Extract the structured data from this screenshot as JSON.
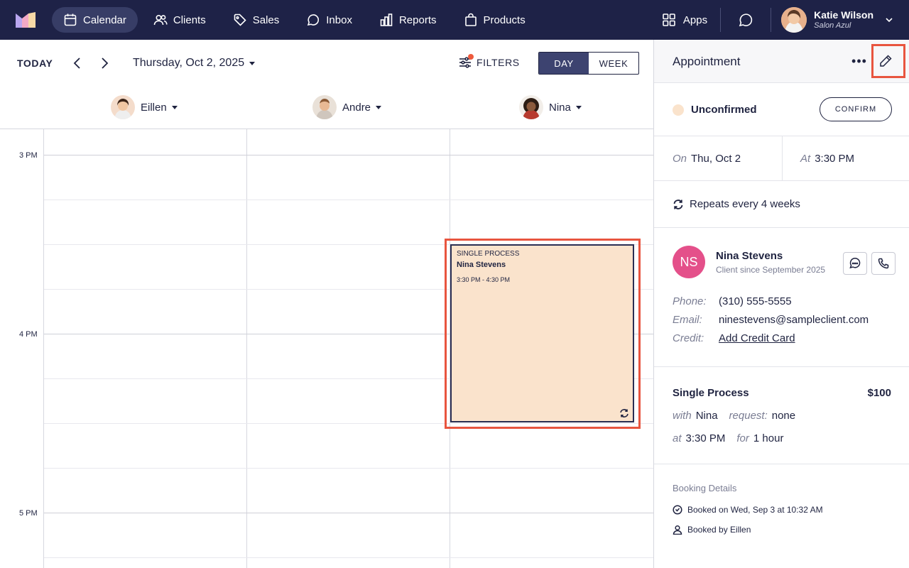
{
  "nav": {
    "items": [
      {
        "label": "Calendar",
        "icon": "calendar-icon"
      },
      {
        "label": "Clients",
        "icon": "users-icon"
      },
      {
        "label": "Sales",
        "icon": "tag-icon"
      },
      {
        "label": "Inbox",
        "icon": "inbox-icon"
      },
      {
        "label": "Reports",
        "icon": "bar-chart-icon"
      },
      {
        "label": "Products",
        "icon": "shopping-bag-icon"
      }
    ],
    "apps_label": "Apps",
    "user_name": "Katie Wilson",
    "user_salon": "Salon Azul"
  },
  "toolbar": {
    "today": "TODAY",
    "date": "Thursday, Oct 2, 2025",
    "filters": "FILTERS",
    "view_day": "DAY",
    "view_week": "WEEK"
  },
  "staff": [
    {
      "name": "Eillen"
    },
    {
      "name": "Andre"
    },
    {
      "name": "Nina"
    }
  ],
  "times": [
    "3 PM",
    "4 PM",
    "5 PM"
  ],
  "appointment_block": {
    "service": "SINGLE PROCESS",
    "client": "Nina Stevens",
    "time": "3:30 PM - 4:30 PM"
  },
  "panel": {
    "title": "Appointment",
    "more": "•••",
    "status": "Unconfirmed",
    "confirm": "CONFIRM",
    "on_label": "On",
    "on_value": "Thu, Oct 2",
    "at_label": "At",
    "at_value": "3:30 PM",
    "repeat": "Repeats every 4 weeks",
    "client": {
      "initials": "NS",
      "name": "Nina Stevens",
      "since": "Client since September 2025",
      "phone_label": "Phone:",
      "phone": "(310) 555-5555",
      "email_label": "Email:",
      "email": "ninestevens@sampleclient.com",
      "credit_label": "Credit:",
      "credit": "Add Credit Card"
    },
    "service": {
      "name": "Single Process",
      "price": "$100",
      "with_label": "with",
      "with_value": "Nina",
      "request_label": "request:",
      "request_value": "none",
      "at_label": "at",
      "at_value": "3:30 PM",
      "for_label": "for",
      "for_value": "1 hour"
    },
    "booking": {
      "title": "Booking Details",
      "booked_on": "Booked on Wed, Sep 3 at 10:32 AM",
      "booked_by": "Booked by Eillen"
    }
  },
  "colors": {
    "nav_bg": "#1e2247",
    "accent_highlight": "#e8553f",
    "appointment_fill": "#fae3cc",
    "client_avatar": "#e4508a"
  }
}
